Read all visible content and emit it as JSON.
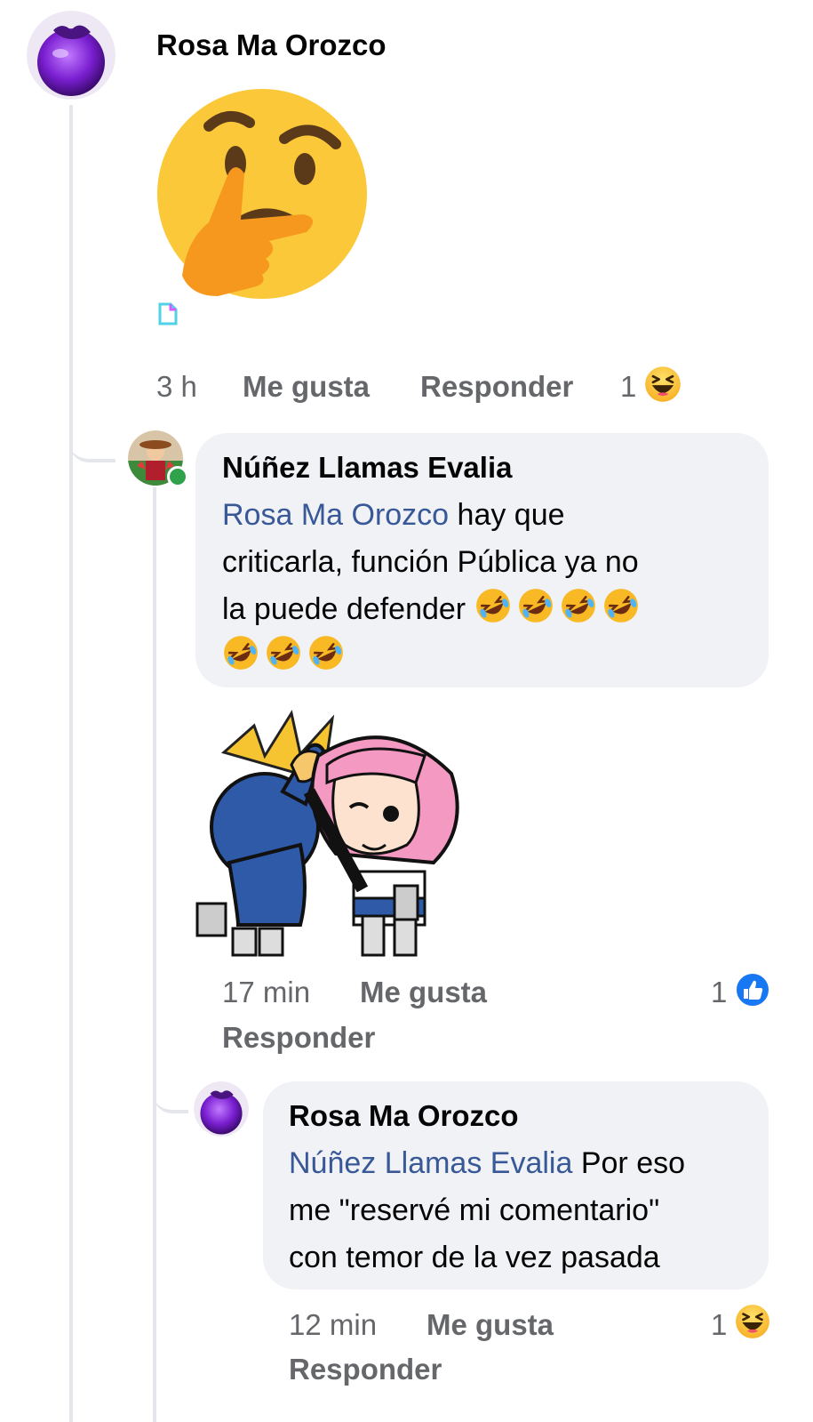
{
  "comment1": {
    "author": "Rosa Ma Orozco",
    "time": "3 h",
    "like_label": "Me gusta",
    "reply_label": "Responder",
    "reaction_count": "1",
    "reaction_icon": "haha-icon"
  },
  "reply1": {
    "author": "Núñez Llamas Evalia",
    "mention": "Rosa Ma Orozco",
    "text_line1": " hay que",
    "text_line2": "criticarla,  función Pública ya no",
    "text_line3": "la puede defender ",
    "emoji_icon": "rolling-laughing-icon",
    "time": "17 min",
    "like_label": "Me gusta",
    "reply_label": "Responder",
    "reaction_count": "1",
    "reaction_icon": "like-icon",
    "online_color": "#31a24c"
  },
  "reply2": {
    "author": "Rosa Ma Orozco",
    "mention": "Núñez Llamas Evalia",
    "text_line1": " Por eso",
    "text_line2": "me \"reservé mi comentario\"",
    "text_line3": "con temor de la vez pasada",
    "time": "12 min",
    "like_label": "Me gusta",
    "reply_label": "Responder",
    "reaction_count": "1",
    "reaction_icon": "haha-icon"
  },
  "colors": {
    "mention": "#385898",
    "bubble": "#f0f2f5",
    "meta": "#65676b",
    "like_blue": "#1877f2"
  }
}
